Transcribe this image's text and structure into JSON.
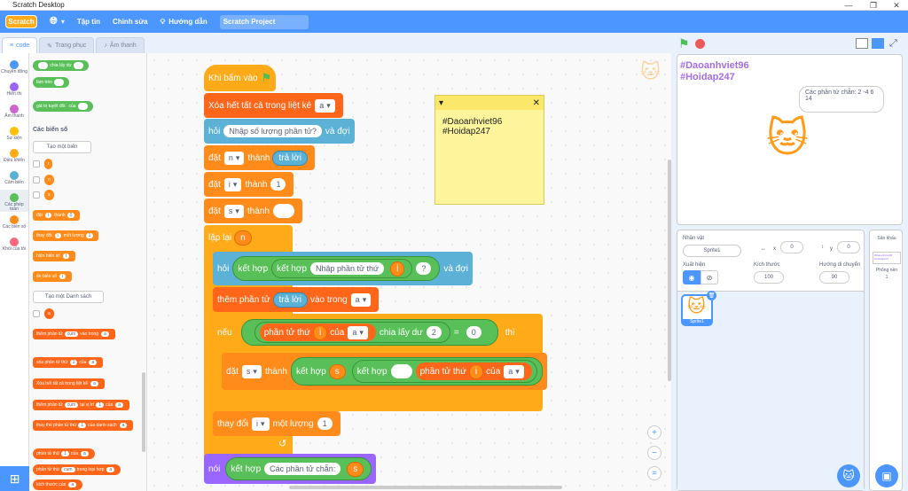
{
  "window": {
    "title": "Scratch Desktop",
    "min": "—",
    "max": "❐",
    "close": "✕"
  },
  "menubar": {
    "logo": "Scratch",
    "file": "Tập tin",
    "edit": "Chỉnh sửa",
    "tutorials": "Hướng dẫn",
    "project": "Scratch Project"
  },
  "tabs": {
    "code": "code",
    "costumes": "Trang phục",
    "sounds": "Âm thanh"
  },
  "categories": [
    {
      "label": "Chuyển động",
      "color": "#4c97ff"
    },
    {
      "label": "Hiển thị",
      "color": "#9966ff"
    },
    {
      "label": "Âm thanh",
      "color": "#cf63cf"
    },
    {
      "label": "Sự kiện",
      "color": "#ffbf00"
    },
    {
      "label": "Điều khiển",
      "color": "#ffab19"
    },
    {
      "label": "Cảm biến",
      "color": "#5cb1d6"
    },
    {
      "label": "Các phép toán",
      "color": "#59c059"
    },
    {
      "label": "Các biến số",
      "color": "#ff8c1a"
    },
    {
      "label": "Khối của tôi",
      "color": "#ff6680"
    }
  ],
  "palette": {
    "mod": "chia lấy dư",
    "round": "làm tròn",
    "abs": "giá trị tuyệt đối",
    "of": "của",
    "vars_title": "Các biến số",
    "make_var": "Tạo một biến",
    "vars": [
      "i",
      "n",
      "s"
    ],
    "set": "đặt",
    "set_to": "thành",
    "set_val": "0",
    "change": "thay đổi",
    "change_by": "một lượng",
    "change_val": "1",
    "show": "hiện biến số",
    "hide": "ẩn biến số",
    "make_list": "Tạo một Danh sách",
    "list": "a",
    "add": "thêm phần tử",
    "add_item": "cụm",
    "add_in": "vào trong",
    "del": "xóa phần tử thứ",
    "del_of": "của",
    "delall": "Xóa hết tất cả trong liệt kê",
    "insert": "thêm phần tử",
    "insert_at": "tại vị trí",
    "insert_of": "của",
    "replace": "thay thế phần tử thứ",
    "replace_of": "của danh sách",
    "replace_by": "bằng",
    "item": "phần tử thứ",
    "item_of": "của",
    "indexof": "phần tử thứ",
    "indexof_in": "trong loại hợp",
    "length": "kích thước của"
  },
  "script": {
    "hat": "Khi bấm vào",
    "delall": "Xóa hết tất cả trong liệt kê",
    "list": "a",
    "ask": "hỏi",
    "ask_q": "Nhập số lượng phần tử?",
    "ask_wait": "và đợi",
    "set": "đặt",
    "to": "thành",
    "answer": "trả lời",
    "var_n": "n",
    "var_i": "i",
    "var_s": "s",
    "one": "1",
    "repeat": "lặp lại",
    "join": "kết hợp",
    "prompt_item": "Nhập phần tử thứ",
    "q": "?",
    "add": "thêm phần tử",
    "into": "vào trong",
    "if": "nếu",
    "item": "phần tử thứ",
    "of": "của",
    "mod": "chia lấy dư",
    "two": "2",
    "eq": "=",
    "zero": "0",
    "then": "thì",
    "change": "thay đổi",
    "by": "một lượng",
    "say": "nói",
    "even": "Các phần tử chẵn:"
  },
  "note": {
    "line1": "#Daoanhviet96",
    "line2": "#Hoidap247"
  },
  "stage": {
    "wm1": "#Daoanhviet96",
    "wm2": "#Hoidap247",
    "bubble": "Các phần tử chẵn: 2 -4 6 14"
  },
  "sprite": {
    "label": "Nhân vật",
    "name": "Sprite1",
    "x_label": "x",
    "x": "0",
    "y_label": "y",
    "y": "0",
    "show": "Xuất hiện",
    "size_label": "Kích thước",
    "size": "100",
    "dir_label": "Hướng di chuyển",
    "dir": "90",
    "thumb": "Sprite1"
  },
  "stagepane": {
    "title": "Sân khấu",
    "backdrops": "Phông nền",
    "count": "1"
  }
}
